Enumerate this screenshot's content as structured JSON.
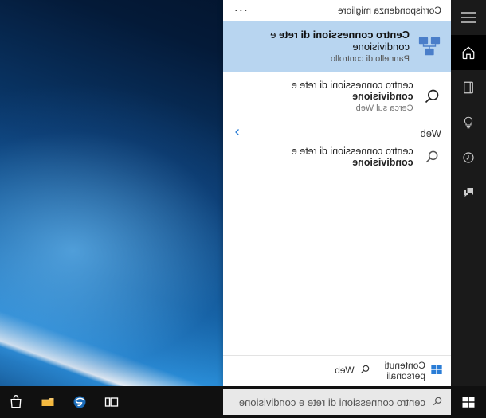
{
  "header": {
    "label": "Corrispondenza migliore",
    "more": "···"
  },
  "best_match": {
    "title_bold": "Centro connessioni di rete",
    "title_rest": "e condivisione",
    "subtitle": "Pannello di controllo"
  },
  "web_result": {
    "title_pre": "centro connessioni di rete e ",
    "title_match": "condivisione",
    "subtitle": "Cerca sul Web"
  },
  "web_section": {
    "heading": "Web",
    "item_pre": "centro connessioni di rete e ",
    "item_match": "condivisione"
  },
  "tabs": {
    "personal_line1": "Contenuti",
    "personal_line2": "personali",
    "web": "Web"
  },
  "search": {
    "value": "centro connessioni di rete e condivisione"
  },
  "colors": {
    "highlight_bg": "#b8d5f0",
    "accent": "#2a7dd6",
    "taskbar": "#101010"
  }
}
